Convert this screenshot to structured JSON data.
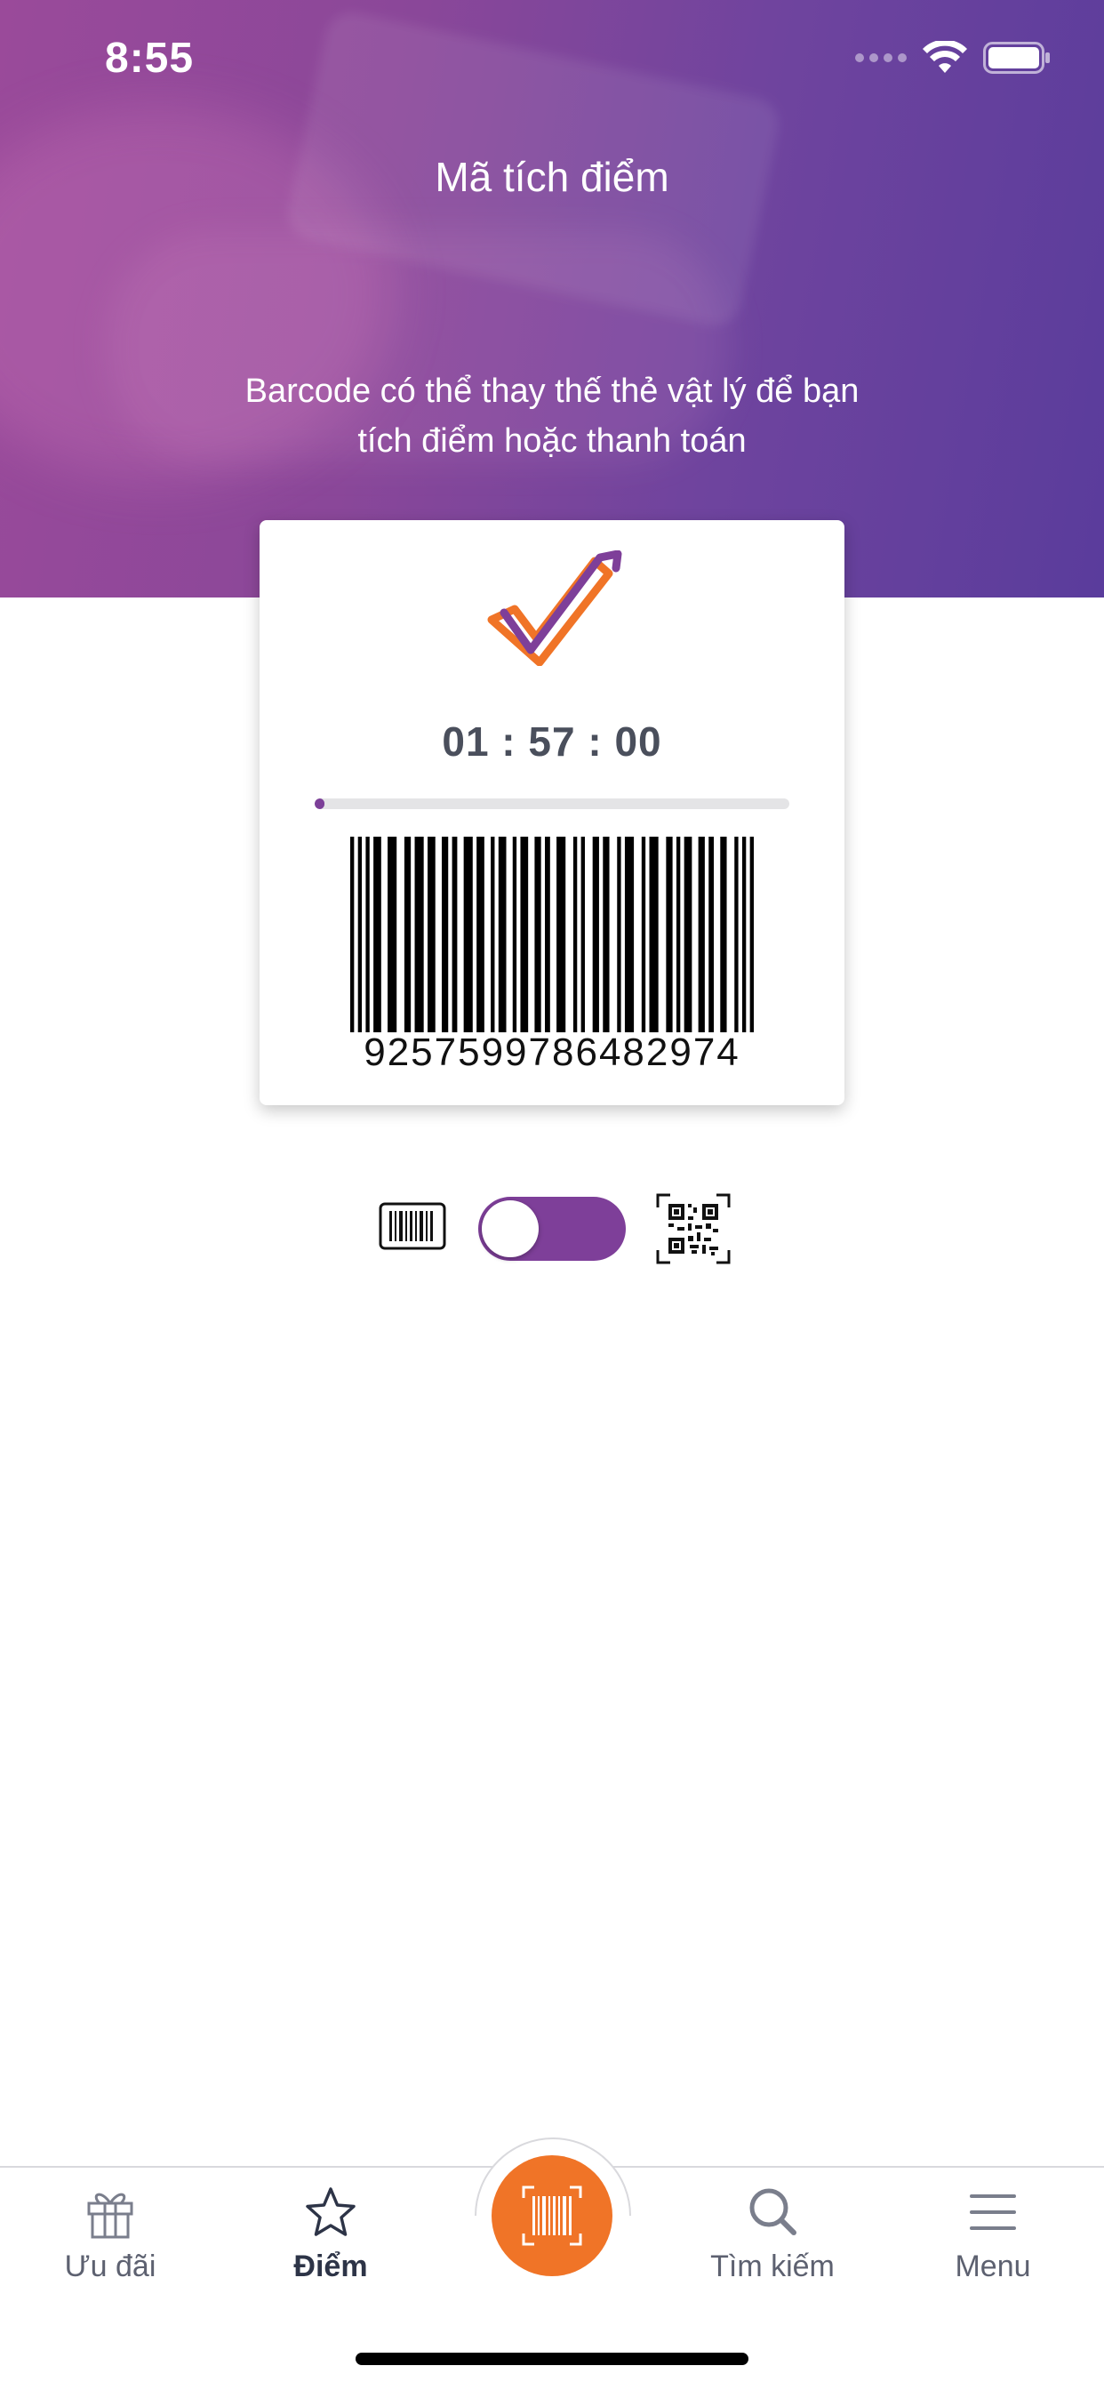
{
  "status_bar": {
    "time": "8:55"
  },
  "header": {
    "title": "Mã tích điểm",
    "subtitle": "Barcode có thể thay thế thẻ vật lý để bạn\ntích điểm hoặc thanh toán"
  },
  "card": {
    "timer": "01 : 57 : 00",
    "progress_fraction": 0.02,
    "barcode_number": "9257599786482974"
  },
  "mode_toggle": {
    "left_icon": "barcode-icon",
    "right_icon": "qr-code-icon",
    "selected": "barcode"
  },
  "tabbar": {
    "items": [
      {
        "label": "Ưu đãi",
        "icon": "gift-icon",
        "active": false
      },
      {
        "label": "Điểm",
        "icon": "star-icon",
        "active": true
      },
      {
        "label": "",
        "icon": "barcode-scan-icon",
        "active": false
      },
      {
        "label": "Tìm kiếm",
        "icon": "search-icon",
        "active": false
      },
      {
        "label": "Menu",
        "icon": "hamburger-menu-icon",
        "active": false
      }
    ]
  },
  "colors": {
    "header_gradient_start": "#9a4a9a",
    "header_gradient_end": "#5a3c9c",
    "accent_purple": "#7e3f99",
    "accent_orange": "#f07427",
    "timer_text": "#4a4f5c"
  }
}
